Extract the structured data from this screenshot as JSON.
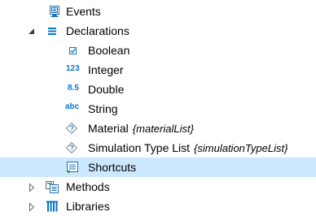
{
  "tree": {
    "events": {
      "label": "Events",
      "icon": "events-icon"
    },
    "declarations": {
      "label": "Declarations",
      "icon": "declarations-icon",
      "expanded": true,
      "children": [
        {
          "label": "Boolean",
          "icon": "boolean-icon",
          "type_badge": ""
        },
        {
          "label": "Integer",
          "icon": "integer-icon",
          "type_badge": "123"
        },
        {
          "label": "Double",
          "icon": "double-icon",
          "type_badge": "8.5"
        },
        {
          "label": "String",
          "icon": "string-icon",
          "type_badge": "abc"
        },
        {
          "label": "Material",
          "icon": "choice-list-icon",
          "meta": "{materialList}"
        },
        {
          "label": "Simulation Type List",
          "icon": "choice-list-icon",
          "meta": "{simulationTypeList}"
        },
        {
          "label": "Shortcuts",
          "icon": "shortcuts-icon",
          "selected": true
        }
      ]
    },
    "methods": {
      "label": "Methods",
      "icon": "methods-icon",
      "expanded": false
    },
    "libraries": {
      "label": "Libraries",
      "icon": "libraries-icon",
      "expanded": false
    }
  },
  "colors": {
    "selection": "#cce8ff",
    "accent": "#0a76c8",
    "choice_icon": "#4d8fc8"
  }
}
